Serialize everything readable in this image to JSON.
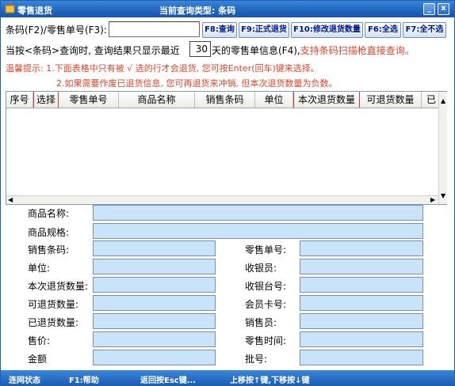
{
  "window": {
    "title": "零售退货",
    "query_type": "当前查询类型: 条码",
    "min_glyph": "_",
    "close_glyph": "x"
  },
  "search": {
    "label": "条码(F2)/零售单号(F3):",
    "value": ""
  },
  "toolbar": {
    "query": "F8:查询",
    "formal_return": "F9:正式退货",
    "modify_qty": "F10:修改退货数量",
    "select_all": "F6:全选",
    "deselect_all": "F7:全不选"
  },
  "recent": {
    "prefix": "当按<条码>查询时, 查询结果只显示最近",
    "days": "30",
    "suffix": "天的零售单信息(F4),",
    "scanner_hint": "支持条码扫描枪直接查询。"
  },
  "tips": {
    "line1": "温馨提示: 1.下面表格中只有被 √ 选的行才会退货, 您可按Enter(回车)键来选择。",
    "line2": "2.如果需要作废已退货信息, 您可再退货来冲销, 但本次退货数量为负数。"
  },
  "grid": {
    "columns": [
      "序号",
      "选择",
      "零售单号",
      "商品名称",
      "销售条码",
      "单位",
      "本次退货数量",
      "可退货数量",
      "已"
    ],
    "rows": []
  },
  "details": {
    "product_name": "商品名称:",
    "product_spec": "商品规格:",
    "sales_barcode": "销售条码:",
    "unit": "单位:",
    "return_qty": "本次退货数量:",
    "returnable_qty": "可退货数量:",
    "returned_qty": "已退货数量:",
    "price": "售价:",
    "amount": "金额",
    "retail_no": "零售单号:",
    "cashier": "收银员:",
    "register_no": "收银台号:",
    "member_card": "会员卡号:",
    "salesperson": "销售员:",
    "retail_time": "零售时间:",
    "batch_no": "批号:"
  },
  "status": {
    "connection": "连网状态",
    "help": "F1:帮助",
    "back": "返回按Esc键...",
    "nav": "上移按↑键,下移按↓键"
  }
}
